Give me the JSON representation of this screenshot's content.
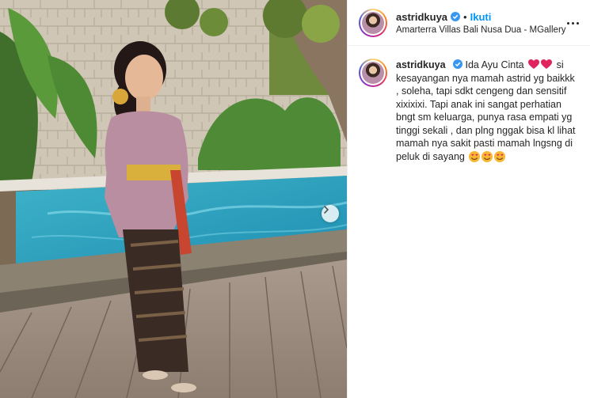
{
  "post": {
    "username": "astridkuya",
    "follow_label": "Ikuti",
    "dot": "•",
    "location": "Amarterra Villas Bali Nusa Dua - MGallery",
    "caption": {
      "username": "astridkuya",
      "part1": "Ida Ayu Cinta",
      "part2": "si kesayangan nya mamah astrid yg baikkk , soleha, tapi sdkt cengeng dan sensitif xixixixi. Tapi anak ini sangat perhatian bngt sm keluarga, punya rasa empati yg tinggi sekali , dan plng nggak bisa kl lihat mamah nya sakit pasti mamah lngsng di peluk di sayang"
    }
  },
  "colors": {
    "link_blue": "#0095f6",
    "heart_red": "#e0245e",
    "verified_blue": "#3897f0"
  },
  "icons": {
    "verified": "verified-badge-icon",
    "more": "more-options-icon",
    "next": "chevron-right-icon",
    "heart": "red-heart-emoji",
    "smile": "smiling-face-with-hearts-emoji"
  }
}
